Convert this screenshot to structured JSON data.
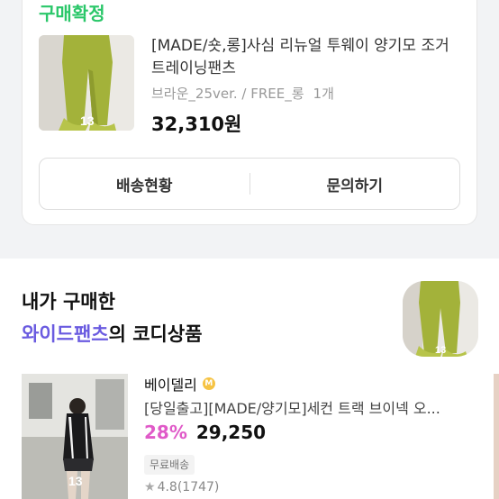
{
  "order": {
    "status": "구매확정",
    "product": {
      "name": "[MADE/숏,롱]사심 리뉴얼 투웨이 양기모 조거 트레이닝팬츠",
      "option": "브라운_25ver. / FREE_롱",
      "quantity": "1개",
      "price": "32,310원",
      "image_mark": "13"
    },
    "buttons": {
      "shipping": "배송현황",
      "inquiry": "문의하기"
    }
  },
  "coordi": {
    "title_line1": "내가 구매한",
    "title_highlight": "와이드팬츠",
    "title_suffix": "의 코디상품",
    "thumb_mark": "13"
  },
  "recommendation": {
    "seller": "베이델리",
    "seller_badge": "M",
    "name": "[당일출고][MADE/양기모]세컨 트랙 브이넥 오...",
    "discount": "28%",
    "price": "29,250",
    "shipping_tag": "무료배송",
    "rating": "4.8(1747)",
    "image_mark": "13"
  },
  "colors": {
    "status_green": "#2ac769",
    "highlight_purple": "#6a5be0",
    "discount_pink": "#e05ac8"
  }
}
